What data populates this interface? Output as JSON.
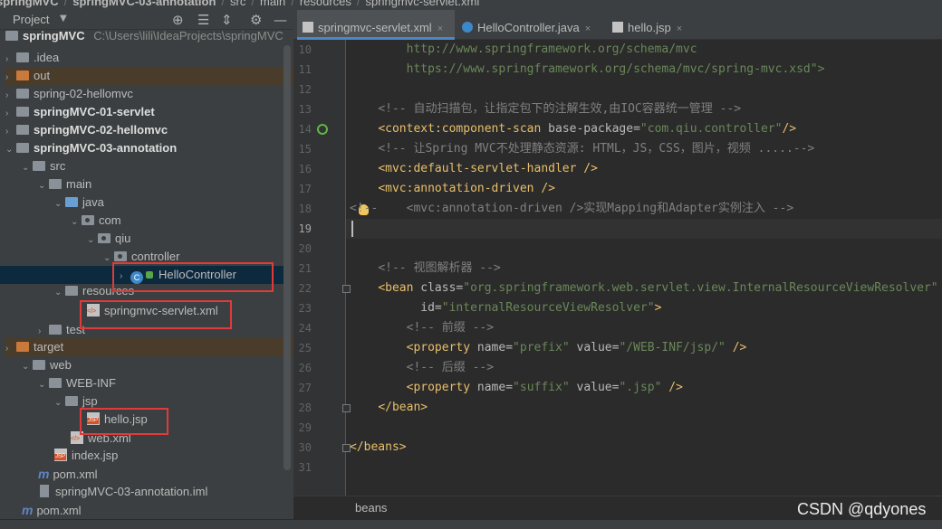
{
  "breadcrumb": {
    "project": "springMVC",
    "module": "springMVC-03-annotation",
    "src": "src",
    "main": "main",
    "resources": "resources",
    "file": "springmvc-servlet.xml"
  },
  "project_panel": {
    "title": "Project",
    "root": "springMVC",
    "root_path": "C:\\Users\\lili\\IdeaProjects\\springMVC",
    "items": {
      "idea": ".idea",
      "out": "out",
      "spring02": "spring-02-hellomvc",
      "mod01": "springMVC-01-servlet",
      "mod02": "springMVC-02-hellomvc",
      "mod03": "springMVC-03-annotation",
      "src": "src",
      "main": "main",
      "java": "java",
      "com": "com",
      "qiu": "qiu",
      "controller": "controller",
      "hello_controller": "HelloController",
      "resources": "resources",
      "servlet_xml": "springmvc-servlet.xml",
      "test": "test",
      "target": "target",
      "web": "web",
      "webinf": "WEB-INF",
      "jsp": "jsp",
      "hello_jsp": "hello.jsp",
      "web_xml": "web.xml",
      "index_jsp": "index.jsp",
      "pom_inner": "pom.xml",
      "iml": "springMVC-03-annotation.iml",
      "pom_outer": "pom.xml"
    }
  },
  "tabs": [
    {
      "label": "springmvc-servlet.xml",
      "active": true
    },
    {
      "label": "HelloController.java",
      "active": false
    },
    {
      "label": "hello.jsp",
      "active": false
    }
  ],
  "editor": {
    "line_numbers": [
      "10",
      "11",
      "12",
      "13",
      "14",
      "15",
      "16",
      "17",
      "18",
      "19",
      "20",
      "21",
      "22",
      "23",
      "24",
      "25",
      "26",
      "27",
      "28",
      "29",
      "30",
      "31"
    ],
    "current_line": "19",
    "code": {
      "l10": "http://www.springframework.org/schema/mvc",
      "l11": "https://www.springframework.org/schema/mvc/spring-mvc.xsd\">",
      "l13": "<!-- 自动扫描包，让指定包下的注解生效,由IOC容器统一管理 -->",
      "l14_tag": "<context",
      "l14_name": ":component-scan",
      "l14_attr": " base-package=",
      "l14_val": "\"com.qiu.controller\"",
      "l14_end": "/>",
      "l15": "<!-- 让Spring MVC不处理静态资源: HTML，JS，CSS，图片，视频 .....-->",
      "l16_tag": "<mvc",
      "l16_name": ":default-servlet-handler",
      "l16_end": " />",
      "l17_tag": "<mvc",
      "l17_name": ":annotation-driven",
      "l17_end": " />",
      "l18": "<!--    <mvc:annotation-driven />实现Mapping和Adapter实例注入 -->",
      "l21": "<!-- 视图解析器 -->",
      "l22_tag": "<bean",
      "l22_attr": " class=",
      "l22_val": "\"org.springframework.web.servlet.view.InternalResourceViewResolver\"",
      "l23_attr": "id=",
      "l23_val": "\"internalResourceViewResolver\"",
      "l23_end": ">",
      "l24": "<!-- 前缀 -->",
      "l25_tag": "<property",
      "l25_a1": " name=",
      "l25_v1": "\"prefix\"",
      "l25_a2": " value=",
      "l25_v2": "\"/WEB-INF/jsp/\"",
      "l25_end": " />",
      "l26": "<!-- 后缀 -->",
      "l27_tag": "<property",
      "l27_a1": " name=",
      "l27_v1": "\"suffix\"",
      "l27_a2": " value=",
      "l27_v2": "\".jsp\"",
      "l27_end": " />",
      "l28": "</bean>",
      "l30": "</beans>"
    }
  },
  "editor_breadcrumb": "beans",
  "watermark": "CSDN @qdyones",
  "colors": {
    "background": "#2b2b2b",
    "panel": "#3c3f41",
    "tag": "#e8bf6a",
    "string": "#6a8759",
    "comment": "#808080",
    "highlight_box": "#e03a3a",
    "selection": "#0d293e"
  }
}
